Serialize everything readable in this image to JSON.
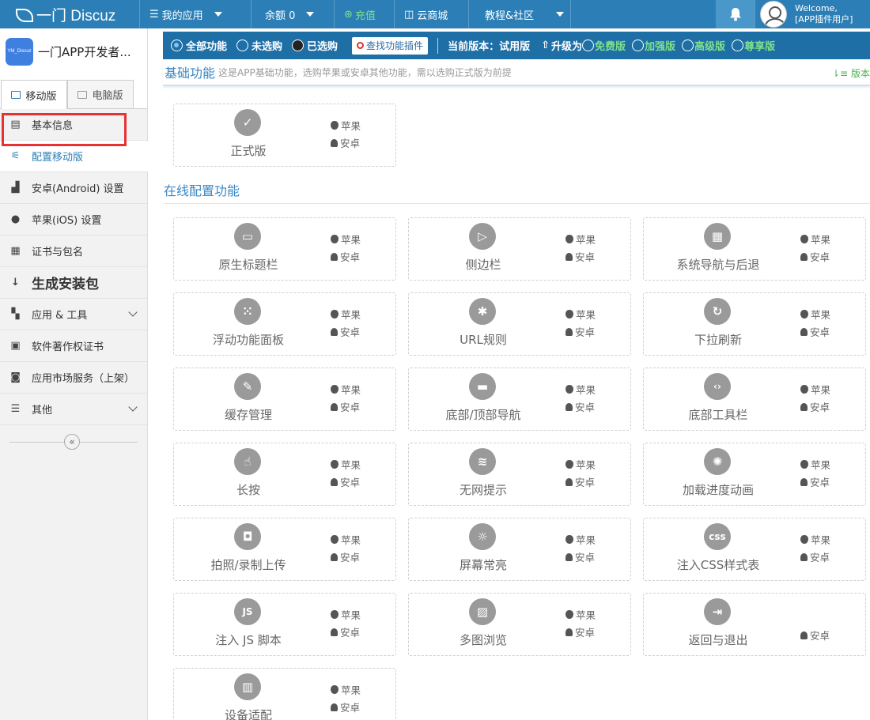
{
  "topbar": {
    "brand": "一门 Discuz",
    "my_apps": "我的应用",
    "balance": "余额 0",
    "recharge": "充值",
    "cloud_store": "云商城",
    "tutorials": "教程&社区",
    "welcome": "Welcome,",
    "username": "[APP插件用户]"
  },
  "sidebar": {
    "app_logo_text": "YM_Discuz",
    "app_name": "一门APP开发者...",
    "tab_mobile": "移动版",
    "tab_pc": "电脑版",
    "items": [
      {
        "label": "基本信息",
        "icon": "document-icon",
        "glyph": "▤"
      },
      {
        "label": "配置移动版",
        "icon": "sliders-icon",
        "glyph": "⚟"
      },
      {
        "label": "安卓(Android) 设置",
        "icon": "android-icon",
        "glyph": "▟"
      },
      {
        "label": "苹果(iOS) 设置",
        "icon": "apple-icon",
        "glyph": "●"
      },
      {
        "label": "证书与包名",
        "icon": "certificate-icon",
        "glyph": "▦"
      },
      {
        "label": "生成安装包",
        "icon": "sort-icon",
        "glyph": "↓"
      },
      {
        "label": "应用 & 工具",
        "icon": "grid-icon",
        "glyph": "▚"
      },
      {
        "label": "软件著作权证书",
        "icon": "copyright-icon",
        "glyph": "▣"
      },
      {
        "label": "应用市场服务（上架）",
        "icon": "store-icon",
        "glyph": "◙"
      },
      {
        "label": "其他",
        "icon": "menu-icon",
        "glyph": "☰"
      }
    ],
    "collapse_glyph": "«"
  },
  "filter": {
    "all": "全部功能",
    "not_bought": "未选购",
    "bought": "已选购",
    "find_plugin": "查找功能插件",
    "current_version_label": "当前版本：",
    "current_version": "试用版",
    "upgrade_label": "升级为",
    "free": "免费版",
    "enhanced": "加强版",
    "advanced": "高级版",
    "premium": "尊享版"
  },
  "basic": {
    "title": "基础功能",
    "desc": "这是APP基础功能，选购苹果或安卓其他功能，需以选购正式版为前提",
    "version_link": "版本"
  },
  "online_title": "在线配置功能",
  "platform": {
    "apple": "苹果",
    "android": "安卓"
  },
  "cards": [
    {
      "name": "正式版",
      "icon": "check-shield-icon",
      "glyph": "✓",
      "apple": true
    },
    {
      "name": "原生标题栏",
      "icon": "titlebar-icon",
      "glyph": "▭",
      "apple": true
    },
    {
      "name": "侧边栏",
      "icon": "sidebar-icon",
      "glyph": "▷",
      "apple": true
    },
    {
      "name": "系统导航与后退",
      "icon": "system-nav-icon",
      "glyph": "▦",
      "apple": true
    },
    {
      "name": "浮动功能面板",
      "icon": "dots-grid-icon",
      "glyph": "⁙",
      "apple": true
    },
    {
      "name": "URL规则",
      "icon": "asterisk-icon",
      "glyph": "✱",
      "apple": true
    },
    {
      "name": "下拉刷新",
      "icon": "refresh-icon",
      "glyph": "↻",
      "apple": true
    },
    {
      "name": "缓存管理",
      "icon": "broom-icon",
      "glyph": "✎",
      "apple": true
    },
    {
      "name": "底部/顶部导航",
      "icon": "nav-bar-icon",
      "glyph": "▬",
      "apple": true
    },
    {
      "name": "底部工具栏",
      "icon": "code-icon",
      "glyph": "‹›",
      "apple": true
    },
    {
      "name": "长按",
      "icon": "hand-pointer-icon",
      "glyph": "☝",
      "apple": true
    },
    {
      "name": "无网提示",
      "icon": "no-wifi-icon",
      "glyph": "≋",
      "apple": true
    },
    {
      "name": "加载进度动画",
      "icon": "spinner-icon",
      "glyph": "✺",
      "apple": true
    },
    {
      "name": "拍照/录制上传",
      "icon": "camera-icon",
      "glyph": "◘",
      "apple": true
    },
    {
      "name": "屏幕常亮",
      "icon": "sun-icon",
      "glyph": "☼",
      "apple": true
    },
    {
      "name": "注入CSS样式表",
      "icon": "css-icon",
      "glyph": "css",
      "apple": true
    },
    {
      "name": "注入 JS 脚本",
      "icon": "js-icon",
      "glyph": "JS",
      "apple": true
    },
    {
      "name": "多图浏览",
      "icon": "image-icon",
      "glyph": "▨",
      "apple": true
    },
    {
      "name": "返回与退出",
      "icon": "exit-icon",
      "glyph": "⇥",
      "apple": false
    },
    {
      "name": "设备适配",
      "icon": "devices-icon",
      "glyph": "▥",
      "apple": true
    }
  ]
}
